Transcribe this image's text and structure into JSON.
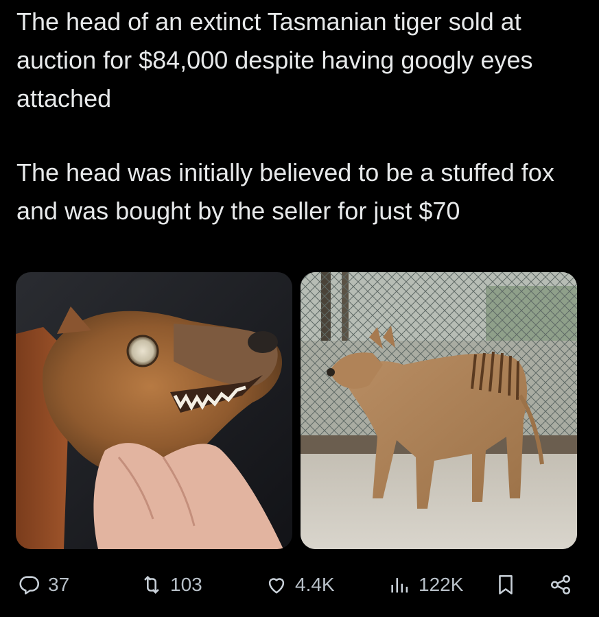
{
  "tweet": {
    "paragraph_1": "The head of an extinct Tasmanian tiger sold at auction for $84,000 despite having googly eyes attached",
    "paragraph_2": "The head was initially believed to be a stuffed fox and was bought by the seller for just $70"
  },
  "actions": {
    "replies": "37",
    "retweets": "103",
    "likes": "4.4K",
    "views": "122K"
  },
  "icons": [
    "reply-icon",
    "retweet-icon",
    "like-icon",
    "views-icon",
    "bookmark-icon",
    "share-icon"
  ],
  "colors": {
    "background": "#000000",
    "text": "#e7e9ea",
    "icon": "#8b98a5"
  }
}
